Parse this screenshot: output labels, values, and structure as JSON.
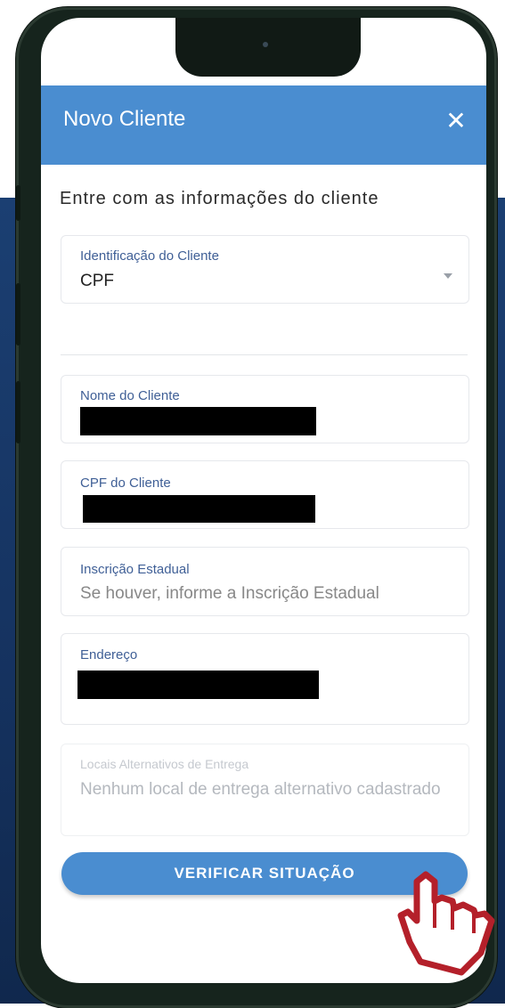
{
  "header": {
    "title": "Novo Cliente",
    "close_icon": "close-icon"
  },
  "form": {
    "intro": "Entre com as informações do cliente",
    "identificacao": {
      "label": "Identificação do Cliente",
      "value": "CPF"
    },
    "nome": {
      "label": "Nome do Cliente",
      "value": ""
    },
    "cpf": {
      "label": "CPF do Cliente",
      "value": ""
    },
    "inscricao": {
      "label": "Inscrição Estadual",
      "placeholder": "Se houver, informe a Inscrição Estadual"
    },
    "endereco": {
      "label": "Endereço",
      "value": ""
    },
    "locais": {
      "label": "Locais Alternativos de Entrega",
      "placeholder": "Nenhum local de entrega alternativo cadastrado"
    }
  },
  "actions": {
    "verify_label": "VERIFICAR SITUAÇÃO"
  },
  "colors": {
    "primary": "#4a8dd0",
    "label_blue": "#3f5f96",
    "background_navy": "#15325f"
  }
}
